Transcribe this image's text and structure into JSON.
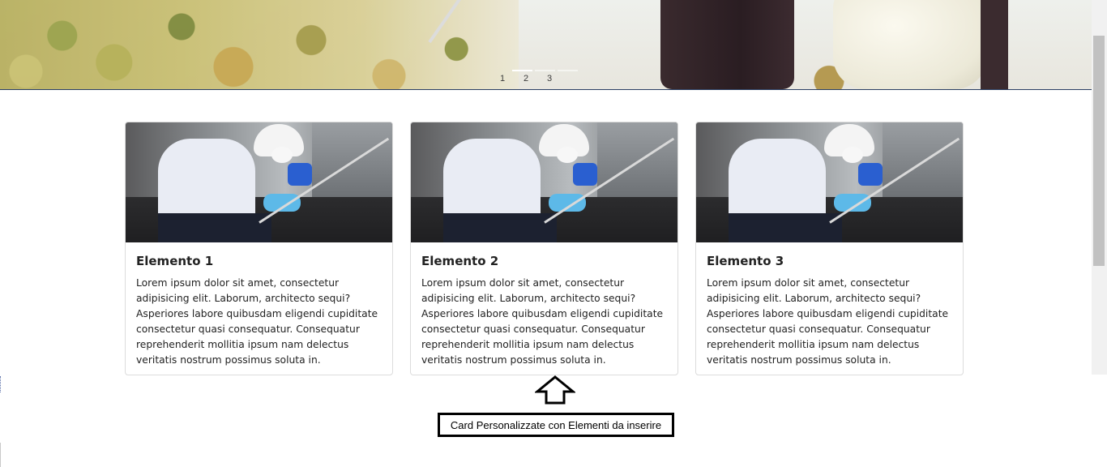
{
  "hero": {
    "indicators": [
      "1",
      "2",
      "3"
    ],
    "active_index": 0
  },
  "cards": [
    {
      "title": "Elemento 1",
      "text": "Lorem ipsum dolor sit amet, consectetur adipisicing elit. Laborum, architecto sequi? Asperiores labore quibusdam eligendi cupiditate consectetur quasi consequatur. Consequatur reprehenderit mollitia ipsum nam delectus veritatis nostrum possimus soluta in."
    },
    {
      "title": "Elemento 2",
      "text": "Lorem ipsum dolor sit amet, consectetur adipisicing elit. Laborum, architecto sequi? Asperiores labore quibusdam eligendi cupiditate consectetur quasi consequatur. Consequatur reprehenderit mollitia ipsum nam delectus veritatis nostrum possimus soluta in."
    },
    {
      "title": "Elemento 3",
      "text": "Lorem ipsum dolor sit amet, consectetur adipisicing elit. Laborum, architecto sequi? Asperiores labore quibusdam eligendi cupiditate consectetur quasi consequatur. Consequatur reprehenderit mollitia ipsum nam delectus veritatis nostrum possimus soluta in."
    }
  ],
  "annotation": {
    "label": "Card Personalizzate con Elementi da inserire",
    "arrow_icon": "up-arrow-icon"
  }
}
